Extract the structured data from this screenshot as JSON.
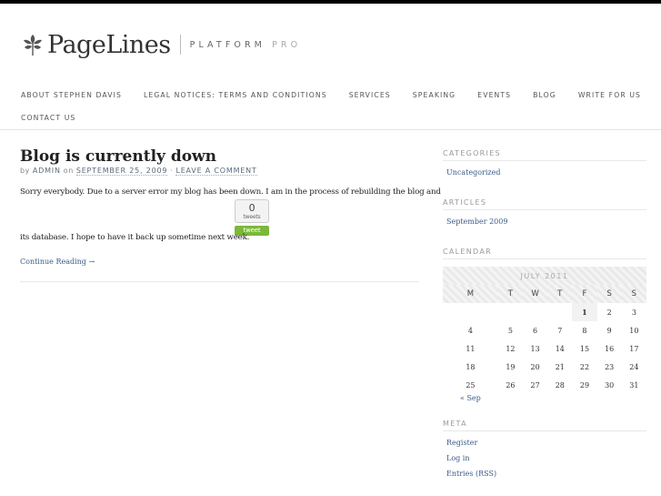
{
  "brand": {
    "name": "PageLines",
    "platform": "PLATFORM",
    "pro": "PRO"
  },
  "nav": {
    "items": [
      "ABOUT STEPHEN DAVIS",
      "LEGAL NOTICES: TERMS AND CONDITIONS",
      "SERVICES",
      "SPEAKING",
      "EVENTS",
      "BLOG",
      "WRITE FOR US",
      "CONTACT US"
    ]
  },
  "post": {
    "title": "Blog is currently down",
    "by": "by",
    "author": "ADMIN",
    "on": "on",
    "date": "SEPTEMBER 25, 2009",
    "dot": "·",
    "comment_link": "LEAVE A COMMENT",
    "body_line1": "Sorry everybody. Due to a server error my blog has been down. I am in the process of rebuilding the blog and",
    "body_line2": "its database. I hope to have it back up sometime next week.",
    "tweet_count": "0",
    "tweet_label": "tweets",
    "tweet_button": "tweet",
    "continue": "Continue Reading →"
  },
  "sidebar": {
    "categories_head": "CATEGORIES",
    "categories": [
      "Uncategorized"
    ],
    "articles_head": "ARTICLES",
    "articles": [
      "September 2009"
    ],
    "calendar_head": "CALENDAR",
    "calendar": {
      "month": "JULY 2011",
      "days_of_week": [
        "M",
        "T",
        "W",
        "T",
        "F",
        "S",
        "S"
      ],
      "weeks": [
        [
          "",
          "",
          "",
          "",
          "1",
          "2",
          "3"
        ],
        [
          "4",
          "5",
          "6",
          "7",
          "8",
          "9",
          "10"
        ],
        [
          "11",
          "12",
          "13",
          "14",
          "15",
          "16",
          "17"
        ],
        [
          "18",
          "19",
          "20",
          "21",
          "22",
          "23",
          "24"
        ],
        [
          "25",
          "26",
          "27",
          "28",
          "29",
          "30",
          "31"
        ]
      ],
      "today": "1",
      "prev": "« Sep"
    },
    "meta_head": "META",
    "meta": [
      "Register",
      "Log in",
      "Entries (RSS)"
    ]
  }
}
